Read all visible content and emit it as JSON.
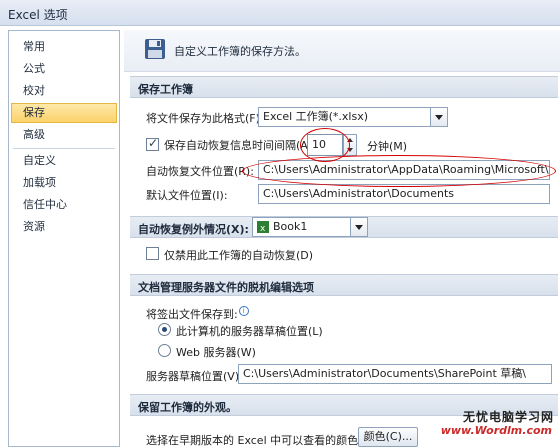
{
  "window": {
    "title": "Excel 选项"
  },
  "sidebar": {
    "items": [
      {
        "label": "常用"
      },
      {
        "label": "公式"
      },
      {
        "label": "校对"
      },
      {
        "label": "保存",
        "selected": true
      },
      {
        "label": "高级"
      },
      {
        "label": "自定义"
      },
      {
        "label": "加载项"
      },
      {
        "label": "信任中心"
      },
      {
        "label": "资源"
      }
    ]
  },
  "header": {
    "text": "自定义工作簿的保存方法。",
    "icon": "floppy-disk-icon"
  },
  "save_workbooks": {
    "section_title": "保存工作簿",
    "format_label": "将文件保存为此格式(F):",
    "format_value": "Excel 工作簿(*.xlsx)",
    "autorecover_label": "保存自动恢复信息时间间隔(A)",
    "autorecover_checked": true,
    "autorecover_minutes": "10",
    "minutes_label": "分钟(M)",
    "autorecover_location_label": "自动恢复文件位置(R):",
    "autorecover_location_value": "C:\\Users\\Administrator\\AppData\\Roaming\\Microsoft\\Excel\\",
    "default_location_label": "默认文件位置(I):",
    "default_location_value": "C:\\Users\\Administrator\\Documents"
  },
  "autorecover_exceptions": {
    "section_title": "自动恢复例外情况(X):",
    "workbook_value": "Book1",
    "disable_label": "仅禁用此工作簿的自动恢复(D)",
    "disable_checked": false
  },
  "offline_editing": {
    "section_title": "文档管理服务器文件的脱机编辑选项",
    "checkout_label": "将签出文件保存到:",
    "option_local_label": "此计算机的服务器草稿位置(L)",
    "option_web_label": "Web 服务器(W)",
    "selected_option": "local",
    "drafts_label": "服务器草稿位置(V):",
    "drafts_value": "C:\\Users\\Administrator\\Documents\\SharePoint 草稿\\"
  },
  "appearance": {
    "section_title": "保留工作簿的外观。",
    "colors_label": "选择在早期版本的 Excel 中可以查看的颜色:",
    "colors_button": "颜色(C)..."
  },
  "watermark": {
    "text": "无忧电脑学习网",
    "url": "www.Wordlm.com"
  },
  "colors": {
    "annotation_red": "#d40000",
    "selected_nav": "#fbd16a",
    "section_bg": "#d7e0ec"
  }
}
